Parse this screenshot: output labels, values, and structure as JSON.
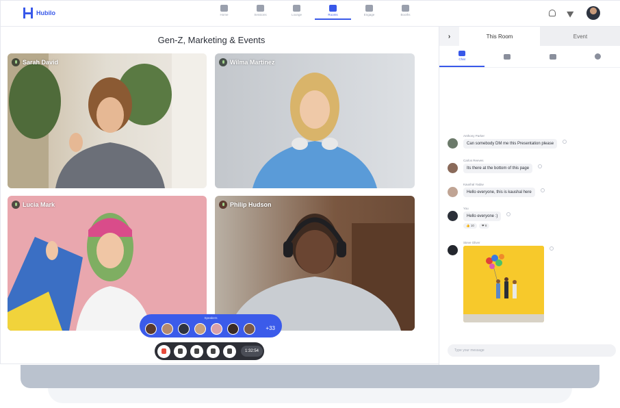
{
  "app": {
    "brand": "Hubilo",
    "brand_color": "#3858e9"
  },
  "nav": {
    "items": [
      {
        "label": "Home",
        "icon": "home-icon"
      },
      {
        "label": "Sessions",
        "icon": "video-icon"
      },
      {
        "label": "Lounge",
        "icon": "lounge-icon"
      },
      {
        "label": "Rooms",
        "icon": "rooms-icon",
        "active": true
      },
      {
        "label": "Engage",
        "icon": "engage-icon"
      },
      {
        "label": "Booths",
        "icon": "booth-icon"
      }
    ]
  },
  "stage": {
    "title": "Gen-Z, Marketing & Events",
    "tiles": [
      {
        "name": "Sarah David"
      },
      {
        "name": "Wilma Martinez"
      },
      {
        "name": "Lucia Mark"
      },
      {
        "name": "Philip Hudson"
      }
    ],
    "participants": {
      "label": "Speakers",
      "more": "+33"
    },
    "controls": {
      "timer": "1:32:54"
    }
  },
  "panel": {
    "collapse": "›",
    "tab_room": "This Room",
    "tab_event": "Event",
    "subtab_chat": "Chat",
    "messages": [
      {
        "sender": "Anthony Parker",
        "text": "Can somebody DM me this Presentation please"
      },
      {
        "sender": "Carlos Reeves",
        "text": "Its there at the bottom of this page"
      },
      {
        "sender": "Kaushal Yadav",
        "text": "Hello everyone, this is kaushal here"
      },
      {
        "sender": "You",
        "text": "Hello everyone :)",
        "reactions": [
          "👍 10",
          "❤ 8"
        ]
      },
      {
        "sender": "Steve Oliver",
        "text": ""
      }
    ],
    "compose_placeholder": "Type your message"
  }
}
